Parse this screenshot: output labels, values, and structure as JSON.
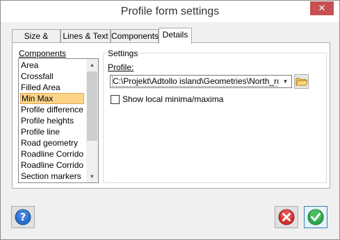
{
  "window": {
    "title": "Profile form settings",
    "close_label": "✕"
  },
  "tabs": [
    {
      "label": "Size & Scale",
      "active": false
    },
    {
      "label": "Lines & Text",
      "active": false
    },
    {
      "label": "Components",
      "active": false
    },
    {
      "label": "Details",
      "active": true
    }
  ],
  "components": {
    "label": "Components",
    "items": [
      "Area",
      "Crossfall",
      "Filled Area",
      "Min Max",
      "Profile difference",
      "Profile heights",
      "Profile line",
      "Road geometry",
      "Roadline Corrido",
      "Roadline Corrido",
      "Section markers"
    ],
    "selected": "Min Max"
  },
  "settings": {
    "group_label": "Settings",
    "profile_label": "Profile:",
    "profile_value": "C:\\Projekt\\Adtollo island\\Geometries\\North_road_",
    "show_local_label": "Show local minima/maxima",
    "show_local_checked": false
  },
  "icons": {
    "help": "help-icon",
    "cancel": "cancel-icon",
    "ok": "ok-icon",
    "folder": "folder-icon"
  },
  "colors": {
    "selection": "#fbd48a",
    "close": "#c75050",
    "help_blue": "#2a6fc9",
    "cancel_red": "#d32f2f",
    "ok_green": "#2fa84a"
  }
}
